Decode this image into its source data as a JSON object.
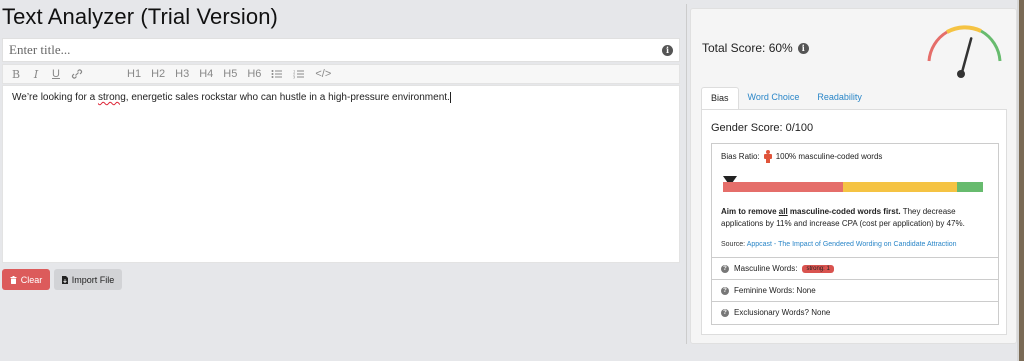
{
  "app": {
    "title": "Text Analyzer (Trial Version)"
  },
  "title_input": {
    "placeholder": "Enter title..."
  },
  "toolbar": {
    "items": [
      "B",
      "I",
      "U",
      "link",
      "H1",
      "H2",
      "H3",
      "H4",
      "H5",
      "H6",
      "ul",
      "ol",
      "</>"
    ]
  },
  "editor": {
    "text_before": "We’re looking for a ",
    "highlight": "strong",
    "text_after": ", energetic sales rockstar who can hustle in a high-pressure environment."
  },
  "buttons": {
    "clear": "Clear",
    "import": "Import File"
  },
  "panel": {
    "total_score": "Total Score: 60%",
    "gauge_level": 0.6,
    "tabs": [
      "Bias",
      "Word Choice",
      "Readability"
    ],
    "active_tab": "Bias",
    "gender_score": "Gender Score: 0/100",
    "bias_ratio_label": "Bias Ratio:",
    "bias_ratio_value": "100% masculine-coded words",
    "bar_marker_level": 0.0,
    "aim_bold_1": "Aim to remove ",
    "aim_bold_all": "all",
    "aim_bold_2": " masculine-coded words first.",
    "aim_rest": " They decrease applications by 11% and increase CPA (cost per application) by 47%.",
    "source_label": "Source:",
    "source_link": "Appcast - The Impact of Gendered Wording on Candidate Attraction",
    "masculine_label": "Masculine Words:",
    "masculine_badge": "strong: 1",
    "feminine": "Feminine Words: None",
    "exclusionary": "Exclusionary Words? None"
  },
  "colors": {
    "clear_button": "#dc5b5b",
    "link": "#2a86c8",
    "bar_red": "#e56e6a",
    "bar_yellow": "#f5c343",
    "bar_green": "#67bb6e"
  }
}
